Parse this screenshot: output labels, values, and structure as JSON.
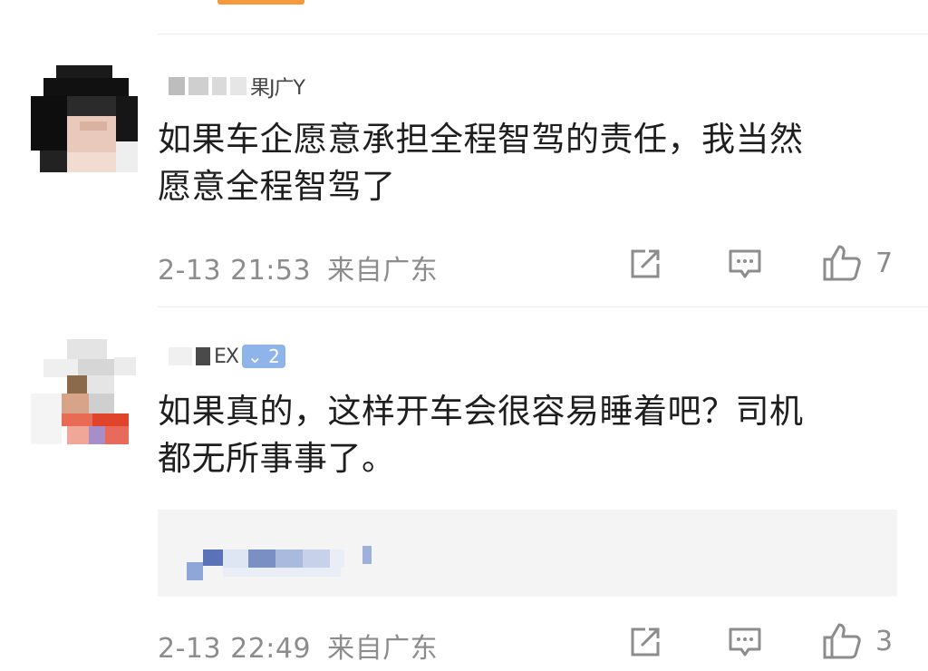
{
  "colors": {
    "accent_tab": "#f59a3c",
    "text": "#1e1e1e",
    "meta": "#8c8c8c",
    "badge": "#8fb4ea"
  },
  "comments": [
    {
      "username_visible": "果J广Y",
      "text_line1": "如果车企愿意承担全程智驾的责任，我当然",
      "text_line2": "愿意全程智驾了",
      "time": "2-13 21:53",
      "location": "来自广东",
      "likes": "7",
      "icons": [
        "share-icon",
        "comment-icon",
        "like-icon"
      ]
    },
    {
      "username_visible": "EX",
      "badge": "2",
      "text_line1": "如果真的，这样开车会很容易睡着吧？司机",
      "text_line2": "都无所事事了。",
      "time": "2-13 22:49",
      "location": "来自广东",
      "likes": "3",
      "icons": [
        "share-icon",
        "comment-icon",
        "like-icon"
      ]
    }
  ]
}
